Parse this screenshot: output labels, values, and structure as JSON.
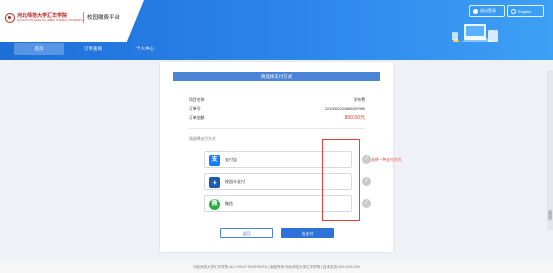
{
  "header": {
    "university_name": "河北师范大学汇华学院",
    "university_sub": "HUIHUA COLLEGE OF HEBEI NORMAL UNIVERSITY",
    "platform_title": "校园缴费平台",
    "user_label": "退出登录",
    "language_label": "English"
  },
  "nav": {
    "home": "首页",
    "orders": "订单查询",
    "personal": "个人中心"
  },
  "card": {
    "title": "请选择支付方式",
    "project_key": "项目名称:",
    "project_value": "学杂费",
    "order_key": "订单号:",
    "order_value": "2210052204885087989",
    "amount_key": "订单金额:",
    "amount_value": "800.00元",
    "methods_title": "请选择支付方式",
    "methods": [
      {
        "label": "支付宝",
        "icon": "alipay-icon",
        "icon_glyph": "支"
      },
      {
        "label": "校园卡支付",
        "icon": "campus-card-icon",
        "icon_glyph": "卡"
      },
      {
        "label": "微信",
        "icon": "wechat-icon",
        "icon_glyph": "微"
      }
    ],
    "back_label": "返回",
    "pay_label": "去支付"
  },
  "annotation": {
    "text": "选择一种支付方式"
  },
  "footer": {
    "text": "河北师范大学汇华学院 ALL RIGHT RESERVED | 版权所有:河北师范大学汇华学院 | 技术支持:400-0000-000"
  },
  "colors": {
    "brand_blue": "#2d86ec",
    "accent_red": "#e8413a",
    "amount_red": "#e0392b"
  }
}
